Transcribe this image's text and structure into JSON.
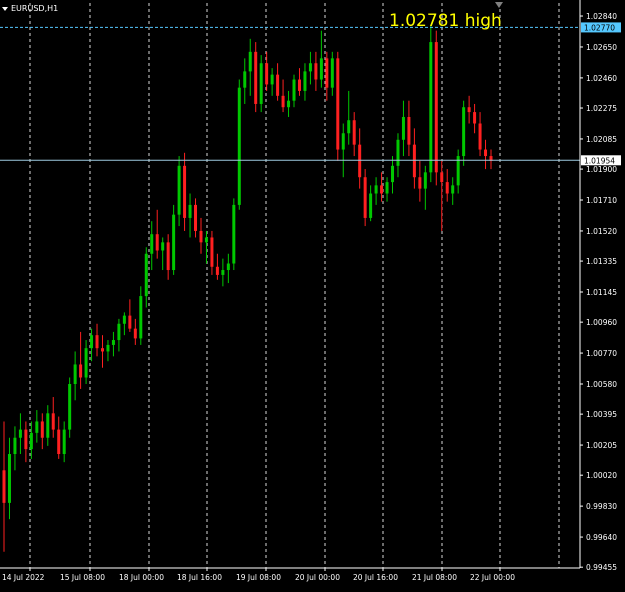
{
  "window": {
    "symbol_timeframe": "EURUSD,H1"
  },
  "annotation": {
    "text": "1.02781 high"
  },
  "price_labels": {
    "high_line": "1.02770",
    "current": "1.01954"
  },
  "colors": {
    "background": "#000000",
    "bull": "#00c800",
    "bear": "#ff2020",
    "grid": "#ffffff",
    "axis_text": "#ffffff",
    "high_line": "#55c8ff",
    "current_line": "#9ecbe0",
    "annotation": "#ffff00"
  },
  "chart_data": {
    "type": "candlestick",
    "title": "EURUSD,H1",
    "ylim": [
      0.9945,
      1.0292
    ],
    "y_ticks": [
      "1.02840",
      "1.02650",
      "1.02460",
      "1.02275",
      "1.02085",
      "1.01900",
      "1.01710",
      "1.01520",
      "1.01335",
      "1.01145",
      "1.00960",
      "1.00770",
      "1.00580",
      "1.00395",
      "1.00205",
      "1.00020",
      "0.99830",
      "0.99640",
      "0.99455"
    ],
    "x_ticks": [
      "14 Jul 2022",
      "15 Jul 08:00",
      "18 Jul 00:00",
      "18 Jul 16:00",
      "19 Jul 08:00",
      "20 Jul 00:00",
      "20 Jul 16:00",
      "21 Jul 08:00",
      "22 Jul 00:00"
    ],
    "high_level": 1.0277,
    "current_price": 1.01954,
    "candles": [
      {
        "o": 1.0005,
        "h": 1.0035,
        "l": 0.9955,
        "c": 0.9985
      },
      {
        "o": 0.9985,
        "h": 1.0025,
        "l": 0.9975,
        "c": 1.0015
      },
      {
        "o": 1.0015,
        "h": 1.0032,
        "l": 1.0005,
        "c": 1.0025
      },
      {
        "o": 1.0025,
        "h": 1.004,
        "l": 1.0015,
        "c": 1.003
      },
      {
        "o": 1.003,
        "h": 1.0035,
        "l": 1.001,
        "c": 1.0018
      },
      {
        "o": 1.0018,
        "h": 1.0035,
        "l": 1.0012,
        "c": 1.0028
      },
      {
        "o": 1.0028,
        "h": 1.0042,
        "l": 1.0022,
        "c": 1.0035
      },
      {
        "o": 1.0035,
        "h": 1.004,
        "l": 1.0018,
        "c": 1.0025
      },
      {
        "o": 1.0025,
        "h": 1.0045,
        "l": 1.002,
        "c": 1.004
      },
      {
        "o": 1.004,
        "h": 1.005,
        "l": 1.0025,
        "c": 1.003
      },
      {
        "o": 1.003,
        "h": 1.0038,
        "l": 1.0012,
        "c": 1.0015
      },
      {
        "o": 1.0015,
        "h": 1.0035,
        "l": 1.001,
        "c": 1.003
      },
      {
        "o": 1.003,
        "h": 1.0062,
        "l": 1.0025,
        "c": 1.0058
      },
      {
        "o": 1.0058,
        "h": 1.0078,
        "l": 1.0048,
        "c": 1.007
      },
      {
        "o": 1.007,
        "h": 1.009,
        "l": 1.0055,
        "c": 1.0062
      },
      {
        "o": 1.0062,
        "h": 1.0085,
        "l": 1.0058,
        "c": 1.008
      },
      {
        "o": 1.008,
        "h": 1.0092,
        "l": 1.0072,
        "c": 1.0088
      },
      {
        "o": 1.0088,
        "h": 1.0095,
        "l": 1.0075,
        "c": 1.008
      },
      {
        "o": 1.008,
        "h": 1.0088,
        "l": 1.0068,
        "c": 1.0078
      },
      {
        "o": 1.0078,
        "h": 1.0085,
        "l": 1.0072,
        "c": 1.0082
      },
      {
        "o": 1.0082,
        "h": 1.009,
        "l": 1.0075,
        "c": 1.0085
      },
      {
        "o": 1.0085,
        "h": 1.0098,
        "l": 1.0078,
        "c": 1.0095
      },
      {
        "o": 1.0095,
        "h": 1.0102,
        "l": 1.0088,
        "c": 1.01
      },
      {
        "o": 1.01,
        "h": 1.011,
        "l": 1.009,
        "c": 1.0092
      },
      {
        "o": 1.0092,
        "h": 1.0098,
        "l": 1.0082,
        "c": 1.0086
      },
      {
        "o": 1.0086,
        "h": 1.0118,
        "l": 1.0082,
        "c": 1.0112
      },
      {
        "o": 1.0112,
        "h": 1.0142,
        "l": 1.0105,
        "c": 1.0138
      },
      {
        "o": 1.0138,
        "h": 1.0158,
        "l": 1.0128,
        "c": 1.015
      },
      {
        "o": 1.015,
        "h": 1.0165,
        "l": 1.0135,
        "c": 1.014
      },
      {
        "o": 1.014,
        "h": 1.0148,
        "l": 1.0128,
        "c": 1.0145
      },
      {
        "o": 1.0145,
        "h": 1.015,
        "l": 1.0122,
        "c": 1.0128
      },
      {
        "o": 1.0128,
        "h": 1.0168,
        "l": 1.0125,
        "c": 1.0162
      },
      {
        "o": 1.0162,
        "h": 1.0198,
        "l": 1.0155,
        "c": 1.0192
      },
      {
        "o": 1.0192,
        "h": 1.02,
        "l": 1.0152,
        "c": 1.016
      },
      {
        "o": 1.016,
        "h": 1.0175,
        "l": 1.0148,
        "c": 1.0168
      },
      {
        "o": 1.0168,
        "h": 1.0172,
        "l": 1.0148,
        "c": 1.0152
      },
      {
        "o": 1.0152,
        "h": 1.016,
        "l": 1.0138,
        "c": 1.0145
      },
      {
        "o": 1.0145,
        "h": 1.0152,
        "l": 1.0132,
        "c": 1.0148
      },
      {
        "o": 1.0148,
        "h": 1.0152,
        "l": 1.0125,
        "c": 1.013
      },
      {
        "o": 1.013,
        "h": 1.0138,
        "l": 1.0122,
        "c": 1.0125
      },
      {
        "o": 1.0125,
        "h": 1.0135,
        "l": 1.0118,
        "c": 1.0128
      },
      {
        "o": 1.0128,
        "h": 1.0138,
        "l": 1.012,
        "c": 1.0132
      },
      {
        "o": 1.0132,
        "h": 1.0172,
        "l": 1.0128,
        "c": 1.0168
      },
      {
        "o": 1.0168,
        "h": 1.0245,
        "l": 1.0165,
        "c": 1.024
      },
      {
        "o": 1.024,
        "h": 1.0258,
        "l": 1.023,
        "c": 1.025
      },
      {
        "o": 1.025,
        "h": 1.027,
        "l": 1.0235,
        "c": 1.0262
      },
      {
        "o": 1.0262,
        "h": 1.0268,
        "l": 1.0225,
        "c": 1.023
      },
      {
        "o": 1.023,
        "h": 1.026,
        "l": 1.0225,
        "c": 1.0255
      },
      {
        "o": 1.0255,
        "h": 1.0262,
        "l": 1.0238,
        "c": 1.0242
      },
      {
        "o": 1.0242,
        "h": 1.0252,
        "l": 1.0235,
        "c": 1.0248
      },
      {
        "o": 1.0248,
        "h": 1.0255,
        "l": 1.0232,
        "c": 1.0235
      },
      {
        "o": 1.0235,
        "h": 1.0245,
        "l": 1.0225,
        "c": 1.0228
      },
      {
        "o": 1.0228,
        "h": 1.0238,
        "l": 1.0222,
        "c": 1.0232
      },
      {
        "o": 1.0232,
        "h": 1.0248,
        "l": 1.0228,
        "c": 1.0245
      },
      {
        "o": 1.0245,
        "h": 1.0252,
        "l": 1.0235,
        "c": 1.0238
      },
      {
        "o": 1.0238,
        "h": 1.0255,
        "l": 1.0232,
        "c": 1.025
      },
      {
        "o": 1.025,
        "h": 1.0262,
        "l": 1.0242,
        "c": 1.0255
      },
      {
        "o": 1.0255,
        "h": 1.0262,
        "l": 1.0238,
        "c": 1.0245
      },
      {
        "o": 1.0245,
        "h": 1.0275,
        "l": 1.024,
        "c": 1.0258
      },
      {
        "o": 1.0258,
        "h": 1.0262,
        "l": 1.0232,
        "c": 1.024
      },
      {
        "o": 1.024,
        "h": 1.0262,
        "l": 1.0235,
        "c": 1.0258
      },
      {
        "o": 1.0258,
        "h": 1.0262,
        "l": 1.0195,
        "c": 1.0202
      },
      {
        "o": 1.0202,
        "h": 1.0218,
        "l": 1.0185,
        "c": 1.0212
      },
      {
        "o": 1.0212,
        "h": 1.0238,
        "l": 1.0205,
        "c": 1.022
      },
      {
        "o": 1.022,
        "h": 1.0225,
        "l": 1.0198,
        "c": 1.0205
      },
      {
        "o": 1.0205,
        "h": 1.0215,
        "l": 1.0178,
        "c": 1.0185
      },
      {
        "o": 1.0185,
        "h": 1.019,
        "l": 1.0155,
        "c": 1.016
      },
      {
        "o": 1.016,
        "h": 1.018,
        "l": 1.0158,
        "c": 1.0175
      },
      {
        "o": 1.0175,
        "h": 1.0185,
        "l": 1.0168,
        "c": 1.018
      },
      {
        "o": 1.018,
        "h": 1.0188,
        "l": 1.017,
        "c": 1.0175
      },
      {
        "o": 1.0175,
        "h": 1.0185,
        "l": 1.017,
        "c": 1.0182
      },
      {
        "o": 1.0182,
        "h": 1.0198,
        "l": 1.0175,
        "c": 1.0192
      },
      {
        "o": 1.0192,
        "h": 1.0212,
        "l": 1.0185,
        "c": 1.0208
      },
      {
        "o": 1.0208,
        "h": 1.0232,
        "l": 1.0198,
        "c": 1.0222
      },
      {
        "o": 1.0222,
        "h": 1.0232,
        "l": 1.0198,
        "c": 1.0205
      },
      {
        "o": 1.0205,
        "h": 1.0215,
        "l": 1.0178,
        "c": 1.0185
      },
      {
        "o": 1.0185,
        "h": 1.0195,
        "l": 1.017,
        "c": 1.0178
      },
      {
        "o": 1.0178,
        "h": 1.0192,
        "l": 1.0165,
        "c": 1.0188
      },
      {
        "o": 1.0188,
        "h": 1.0278,
        "l": 1.0182,
        "c": 1.0268
      },
      {
        "o": 1.0268,
        "h": 1.0275,
        "l": 1.018,
        "c": 1.0188
      },
      {
        "o": 1.0188,
        "h": 1.0195,
        "l": 1.0152,
        "c": 1.0182
      },
      {
        "o": 1.0182,
        "h": 1.019,
        "l": 1.017,
        "c": 1.0175
      },
      {
        "o": 1.0175,
        "h": 1.0185,
        "l": 1.0168,
        "c": 1.018
      },
      {
        "o": 1.018,
        "h": 1.0202,
        "l": 1.0175,
        "c": 1.0198
      },
      {
        "o": 1.0198,
        "h": 1.0232,
        "l": 1.0192,
        "c": 1.0228
      },
      {
        "o": 1.0228,
        "h": 1.0235,
        "l": 1.0218,
        "c": 1.0225
      },
      {
        "o": 1.0225,
        "h": 1.023,
        "l": 1.0212,
        "c": 1.0218
      },
      {
        "o": 1.0218,
        "h": 1.0225,
        "l": 1.0198,
        "c": 1.0202
      },
      {
        "o": 1.0202,
        "h": 1.0208,
        "l": 1.019,
        "c": 1.0198
      },
      {
        "o": 1.0198,
        "h": 1.0202,
        "l": 1.019,
        "c": 1.0195
      }
    ]
  }
}
